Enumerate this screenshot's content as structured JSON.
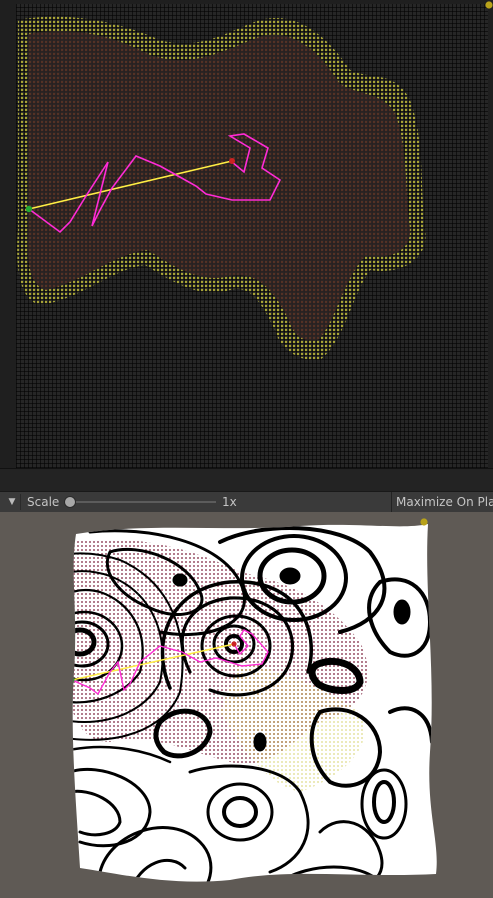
{
  "toolbar": {
    "scale_label": "Scale",
    "scale_value": "1x",
    "maximize_label": "Maximize On Play"
  },
  "icons": {
    "dropdown": "triangle-down-icon",
    "scene_gizmo": "gizmo-dot-icon"
  },
  "colors": {
    "path_line": "#ff2bd6",
    "straight_line": "#ffee44",
    "start_point": "#22aa33",
    "end_point": "#cc2222",
    "grid_points": "#d7d13a",
    "obstacle_fill": "#3a2828",
    "contour": "#000000",
    "map_bg": "#ffffff"
  }
}
